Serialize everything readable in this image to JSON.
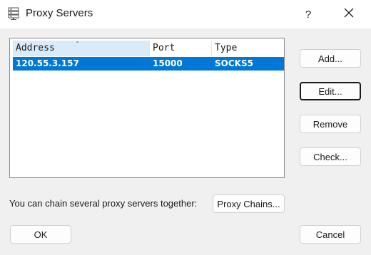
{
  "window": {
    "title": "Proxy Servers",
    "help_label": "?"
  },
  "table": {
    "columns": [
      "Address",
      "Port",
      "Type"
    ],
    "sort_indicator": "ˆ",
    "rows": [
      {
        "address": "120.55.3.157",
        "port": "15000",
        "type": "SOCKS5",
        "selected": true
      }
    ]
  },
  "buttons": {
    "add": "Add...",
    "edit": "Edit...",
    "remove": "Remove",
    "check": "Check...",
    "proxy_chains": "Proxy Chains...",
    "ok": "OK",
    "cancel": "Cancel"
  },
  "footnote": "You can chain several proxy servers together:",
  "colors": {
    "selection": "#0078d7",
    "header_sorted": "#d9ebf9",
    "dialog_bg": "#f0f0f0"
  },
  "icons": {
    "app": "server-stack-icon",
    "close": "close-icon"
  }
}
